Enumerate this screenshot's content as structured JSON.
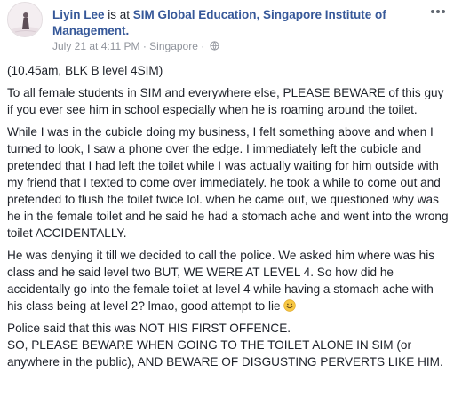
{
  "post": {
    "author": "Liyin Lee",
    "verb": " is at ",
    "place": "SIM Global Education, Singapore Institute of Management.",
    "date": "July 21 at 4:11 PM",
    "sep1": " · ",
    "location": "Singapore",
    "sep2": " · ",
    "privacy_icon": "globe-icon",
    "options_icon": "more-options-icon",
    "emoji": "smiley-emoji",
    "paragraphs": {
      "p0": "(10.45am, BLK B level 4SIM)",
      "p1": "To all female students in SIM and everywhere else, PLEASE BEWARE of this guy if you ever see him in school especially when he is roaming around the toilet.",
      "p2": "While I was in the cubicle doing my business, I felt something above and when I turned to look, I saw a phone over the edge. I immediately left the cubicle and pretended that I had left the toilet while I was actually waiting for him outside with my friend that I texted to come over immediately. he took a while to come out and pretended to flush the toilet twice lol. when he came out, we questioned why was he in the female toilet and he said he had a stomach ache and went into the wrong toilet ACCIDENTALLY.",
      "p3": "He was denying it till we decided to call the police. We asked him where was his class and he said level two BUT, WE WERE AT LEVEL 4. So how did he accidentally go into the female toilet at level 4 while having a stomach ache with his class being at level 2? lmao, good attempt to lie",
      "p4a": "Police said that this was NOT HIS FIRST OFFENCE.",
      "p4b": "SO, PLEASE BEWARE WHEN GOING TO THE TOILET ALONE IN SIM (or anywhere in the public), AND BEWARE OF DISGUSTING PERVERTS LIKE HIM."
    }
  },
  "colors": {
    "link": "#365899",
    "text": "#1d2129",
    "meta": "#90949c",
    "emoji": "#f7c843"
  }
}
